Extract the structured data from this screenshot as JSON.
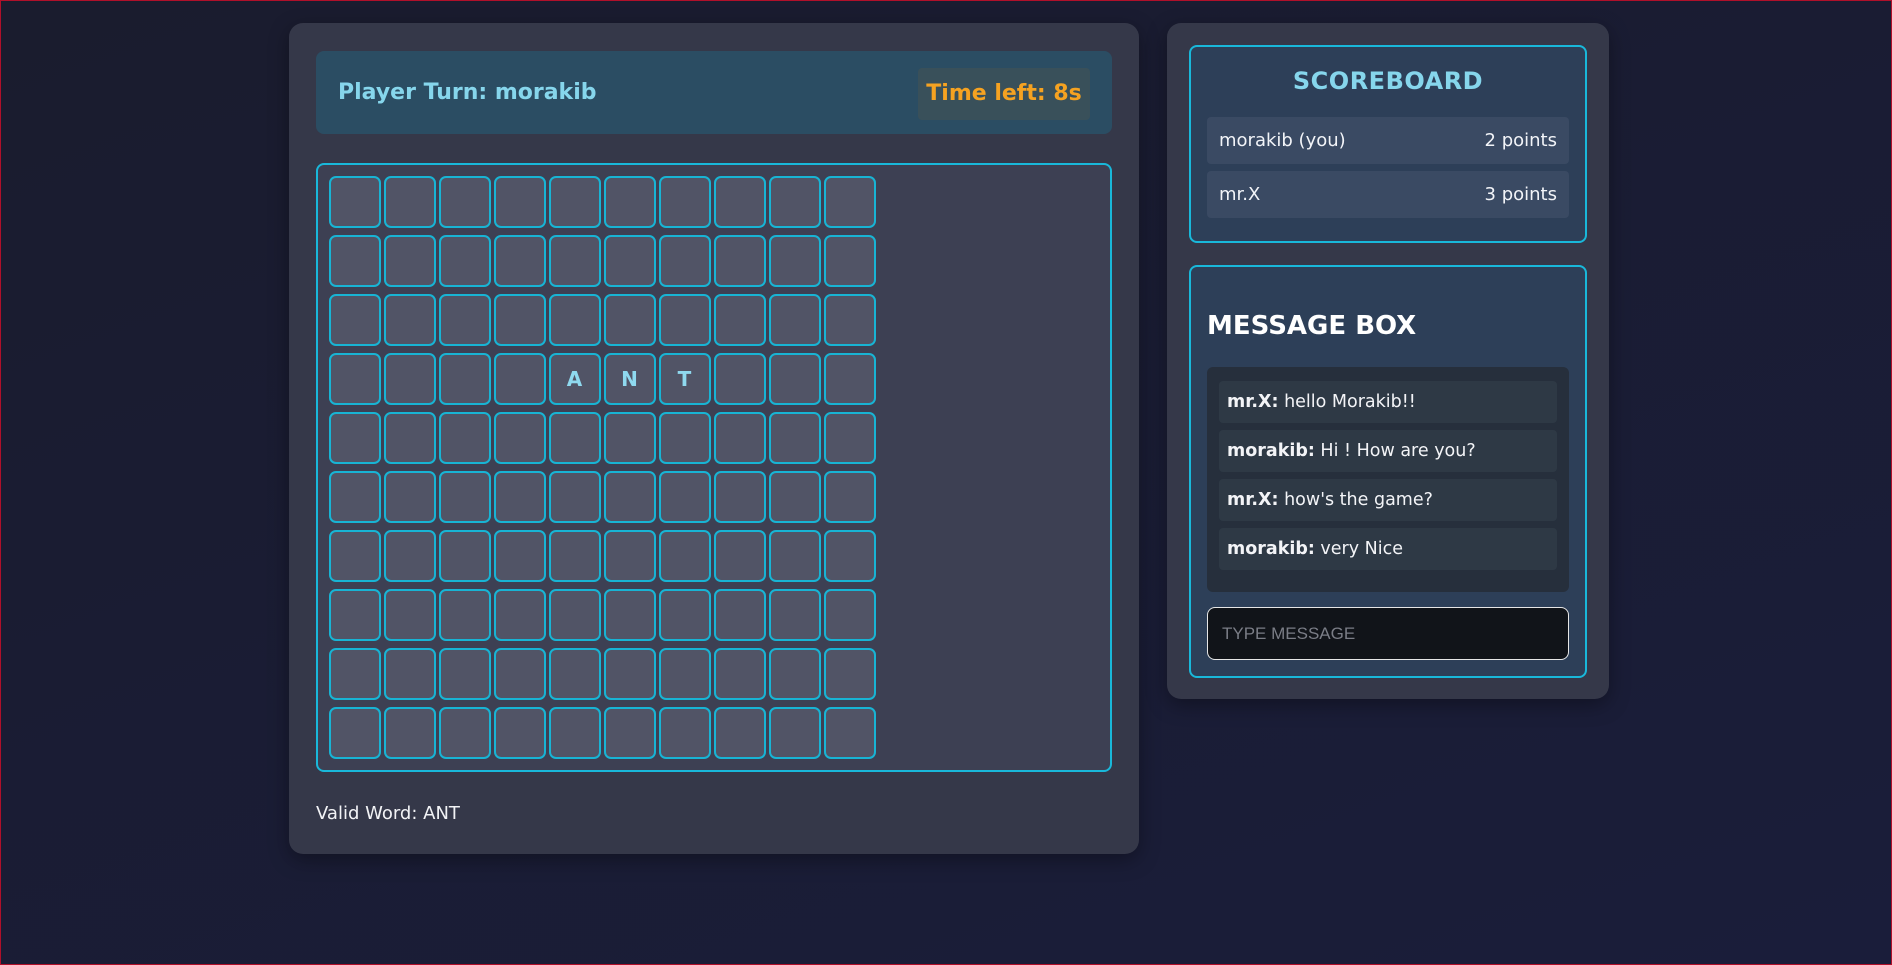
{
  "game": {
    "turn_label": "Player Turn: morakib",
    "timer_label": "Time left: 8s",
    "valid_word_label": "Valid Word: ANT",
    "board_rows": [
      [
        "",
        "",
        "",
        "",
        "",
        "",
        "",
        "",
        "",
        ""
      ],
      [
        "",
        "",
        "",
        "",
        "",
        "",
        "",
        "",
        "",
        ""
      ],
      [
        "",
        "",
        "",
        "",
        "",
        "",
        "",
        "",
        "",
        ""
      ],
      [
        "",
        "",
        "",
        "",
        "A",
        "N",
        "T",
        "",
        "",
        ""
      ],
      [
        "",
        "",
        "",
        "",
        "",
        "",
        "",
        "",
        "",
        ""
      ],
      [
        "",
        "",
        "",
        "",
        "",
        "",
        "",
        "",
        "",
        ""
      ],
      [
        "",
        "",
        "",
        "",
        "",
        "",
        "",
        "",
        "",
        ""
      ],
      [
        "",
        "",
        "",
        "",
        "",
        "",
        "",
        "",
        "",
        ""
      ],
      [
        "",
        "",
        "",
        "",
        "",
        "",
        "",
        "",
        "",
        ""
      ],
      [
        "",
        "",
        "",
        "",
        "",
        "",
        "",
        "",
        "",
        ""
      ]
    ]
  },
  "scoreboard": {
    "title": "SCOREBOARD",
    "players": [
      {
        "name": "morakib (you)",
        "score": "2 points"
      },
      {
        "name": "mr.X",
        "score": "3 points"
      }
    ]
  },
  "messages": {
    "title": "MESSAGE BOX",
    "items": [
      {
        "sender": "mr.X:",
        "text": " hello Morakib!!"
      },
      {
        "sender": "morakib:",
        "text": " Hi ! How are you?"
      },
      {
        "sender": "mr.X:",
        "text": " how's the game?"
      },
      {
        "sender": "morakib:",
        "text": " very Nice"
      }
    ],
    "input_value": "",
    "input_placeholder": "TYPE MESSAGE"
  },
  "colors": {
    "accent": "#19b8da",
    "title_cyan": "#86d6ec",
    "timer_orange": "#f5a221",
    "panel": "#353849",
    "background": "#1a1c2e"
  }
}
